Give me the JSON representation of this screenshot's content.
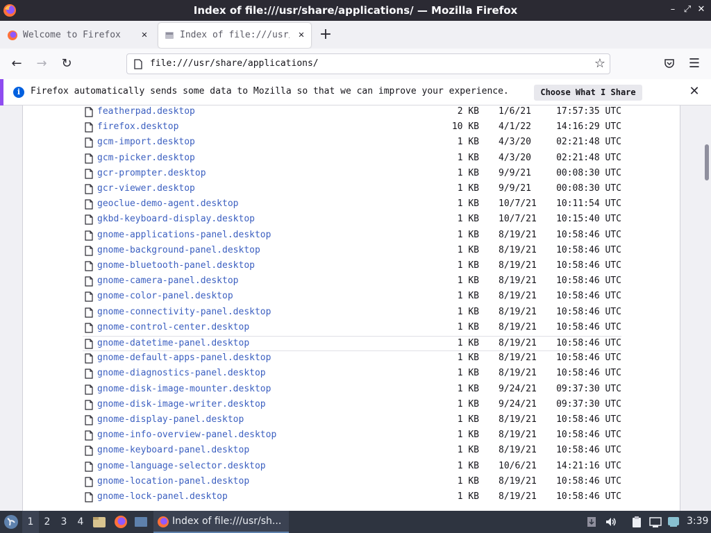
{
  "window": {
    "title": "Index of file:///usr/share/applications/ — Mozilla Firefox",
    "min": "–",
    "max": "⤢",
    "close": "✕"
  },
  "tabs": [
    {
      "label": "Welcome to Firefox",
      "active": false
    },
    {
      "label": "Index of file:///usr/share/applications/",
      "active": true
    }
  ],
  "newtab_label": "+",
  "nav": {
    "back": "←",
    "forward": "→",
    "reload": "↻",
    "url": "file:///usr/share/applications/",
    "star": "☆",
    "pocket": "♡",
    "menu": "☰"
  },
  "notification": {
    "info": "i",
    "message": "Firefox automatically sends some data to Mozilla so that we can improve your experience.",
    "button": "Choose What I Share",
    "close": "✕"
  },
  "files": [
    {
      "name": "featherpad.desktop",
      "size": "2 KB",
      "date": "1/6/21",
      "time": "17:57:35 UTC"
    },
    {
      "name": "firefox.desktop",
      "size": "10 KB",
      "date": "4/1/22",
      "time": "14:16:29 UTC"
    },
    {
      "name": "gcm-import.desktop",
      "size": "1 KB",
      "date": "4/3/20",
      "time": "02:21:48 UTC"
    },
    {
      "name": "gcm-picker.desktop",
      "size": "1 KB",
      "date": "4/3/20",
      "time": "02:21:48 UTC"
    },
    {
      "name": "gcr-prompter.desktop",
      "size": "1 KB",
      "date": "9/9/21",
      "time": "00:08:30 UTC"
    },
    {
      "name": "gcr-viewer.desktop",
      "size": "1 KB",
      "date": "9/9/21",
      "time": "00:08:30 UTC"
    },
    {
      "name": "geoclue-demo-agent.desktop",
      "size": "1 KB",
      "date": "10/7/21",
      "time": "10:11:54 UTC"
    },
    {
      "name": "gkbd-keyboard-display.desktop",
      "size": "1 KB",
      "date": "10/7/21",
      "time": "10:15:40 UTC"
    },
    {
      "name": "gnome-applications-panel.desktop",
      "size": "1 KB",
      "date": "8/19/21",
      "time": "10:58:46 UTC"
    },
    {
      "name": "gnome-background-panel.desktop",
      "size": "1 KB",
      "date": "8/19/21",
      "time": "10:58:46 UTC"
    },
    {
      "name": "gnome-bluetooth-panel.desktop",
      "size": "1 KB",
      "date": "8/19/21",
      "time": "10:58:46 UTC"
    },
    {
      "name": "gnome-camera-panel.desktop",
      "size": "1 KB",
      "date": "8/19/21",
      "time": "10:58:46 UTC"
    },
    {
      "name": "gnome-color-panel.desktop",
      "size": "1 KB",
      "date": "8/19/21",
      "time": "10:58:46 UTC"
    },
    {
      "name": "gnome-connectivity-panel.desktop",
      "size": "1 KB",
      "date": "8/19/21",
      "time": "10:58:46 UTC"
    },
    {
      "name": "gnome-control-center.desktop",
      "size": "1 KB",
      "date": "8/19/21",
      "time": "10:58:46 UTC"
    },
    {
      "name": "gnome-datetime-panel.desktop",
      "size": "1 KB",
      "date": "8/19/21",
      "time": "10:58:46 UTC",
      "hover": true
    },
    {
      "name": "gnome-default-apps-panel.desktop",
      "size": "1 KB",
      "date": "8/19/21",
      "time": "10:58:46 UTC"
    },
    {
      "name": "gnome-diagnostics-panel.desktop",
      "size": "1 KB",
      "date": "8/19/21",
      "time": "10:58:46 UTC"
    },
    {
      "name": "gnome-disk-image-mounter.desktop",
      "size": "1 KB",
      "date": "9/24/21",
      "time": "09:37:30 UTC"
    },
    {
      "name": "gnome-disk-image-writer.desktop",
      "size": "1 KB",
      "date": "9/24/21",
      "time": "09:37:30 UTC"
    },
    {
      "name": "gnome-display-panel.desktop",
      "size": "1 KB",
      "date": "8/19/21",
      "time": "10:58:46 UTC"
    },
    {
      "name": "gnome-info-overview-panel.desktop",
      "size": "1 KB",
      "date": "8/19/21",
      "time": "10:58:46 UTC"
    },
    {
      "name": "gnome-keyboard-panel.desktop",
      "size": "1 KB",
      "date": "8/19/21",
      "time": "10:58:46 UTC"
    },
    {
      "name": "gnome-language-selector.desktop",
      "size": "1 KB",
      "date": "10/6/21",
      "time": "14:21:16 UTC"
    },
    {
      "name": "gnome-location-panel.desktop",
      "size": "1 KB",
      "date": "8/19/21",
      "time": "10:58:46 UTC"
    },
    {
      "name": "gnome-lock-panel.desktop",
      "size": "1 KB",
      "date": "8/19/21",
      "time": "10:58:46 UTC"
    }
  ],
  "taskbar": {
    "workspaces": [
      "1",
      "2",
      "3",
      "4"
    ],
    "active_workspace": "1",
    "task_label": "Index of file:///usr/sh...",
    "clock": "3:39"
  },
  "colors": {
    "link": "#3b5fc0",
    "titlebar": "#2b2a33",
    "taskbar": "#2e3440",
    "accent": "#8f4cf0"
  }
}
